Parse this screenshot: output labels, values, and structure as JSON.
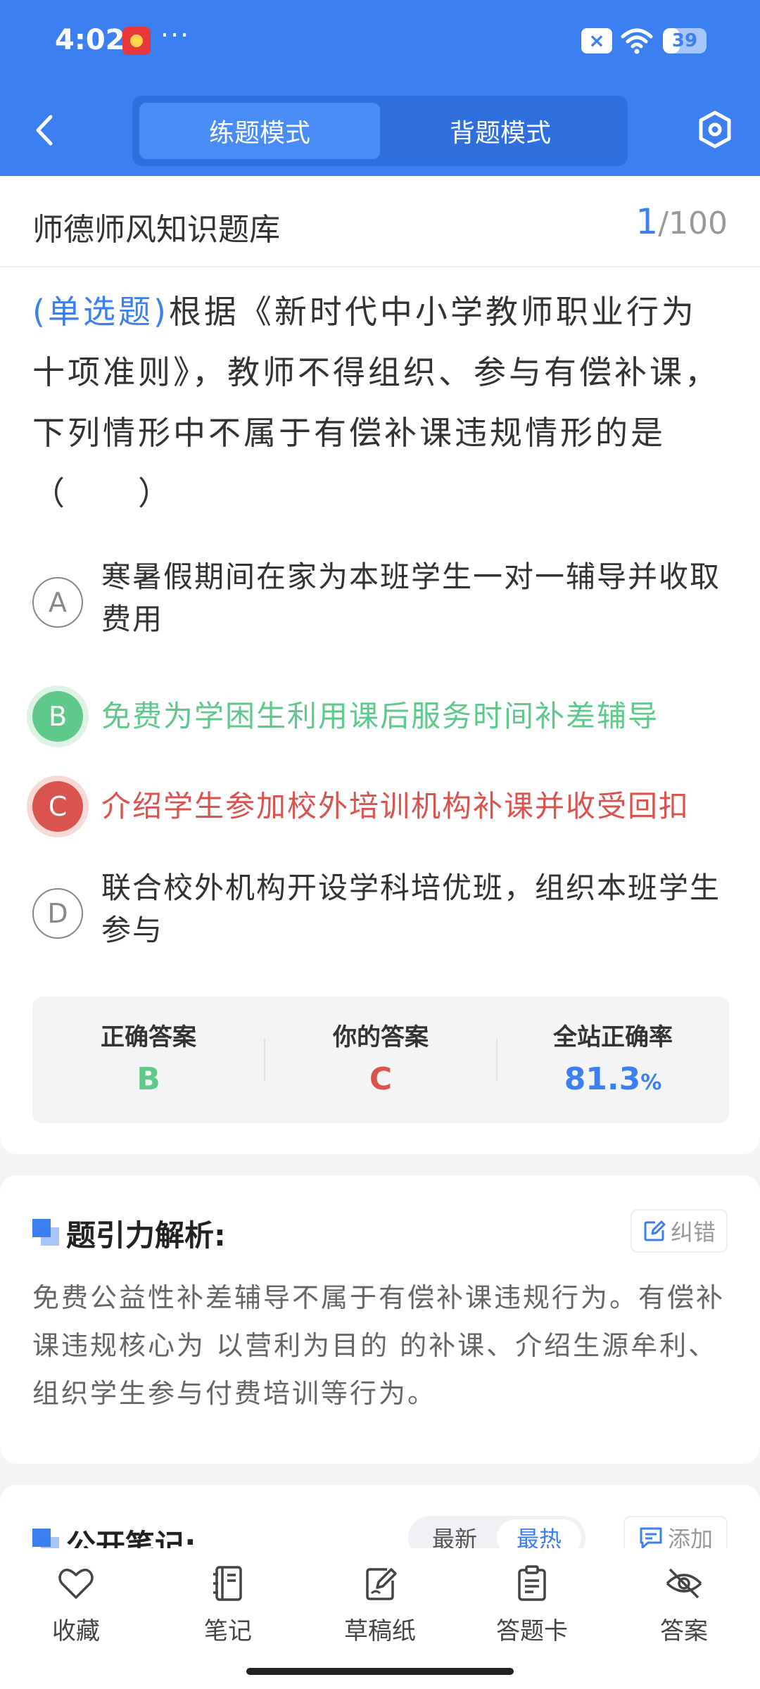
{
  "status_bar": {
    "time": "4:02",
    "more": "···",
    "battery_level": "39",
    "battery_fraction": 0.39
  },
  "top_bar": {
    "modes": [
      "练题模式",
      "背题模式"
    ],
    "active_mode": "练题模式"
  },
  "question_card": {
    "bank_title": "师德师风知识题库",
    "current_index": "1",
    "total": "/100",
    "question_type": "(单选题)",
    "question_text": "根据《新时代中小学教师职业行为十项准则》，教师不得组织、参与有偿补课，下列情形中不属于有偿补课违规情形的是（　　）",
    "options": [
      {
        "letter": "A",
        "text": "寒暑假期间在家为本班学生一对一辅导并收取费用",
        "state": "normal"
      },
      {
        "letter": "B",
        "text": "免费为学困生利用课后服务时间补差辅导",
        "state": "correct"
      },
      {
        "letter": "C",
        "text": "介绍学生参加校外培训机构补课并收受回扣",
        "state": "wrong"
      },
      {
        "letter": "D",
        "text": "联合校外机构开设学科培优班，组织本班学生参与",
        "state": "normal"
      }
    ],
    "stats": {
      "correct_label": "正确答案",
      "correct_value": "B",
      "yours_label": "你的答案",
      "yours_value": "C",
      "rate_label": "全站正确率",
      "rate_value": "81.3",
      "rate_unit": "%"
    }
  },
  "analysis": {
    "title": "题引力解析:",
    "correct_button": "纠错",
    "text": "免费公益性补差辅导不属于有偿补课违规行为。有偿补课违规核心为 以营利为目的 的补课、介绍生源牟利、组织学生参与付费培训等行为。"
  },
  "notes": {
    "title": "公开笔记:",
    "sort_latest": "最新",
    "sort_hot": "最热",
    "add_button": "添加"
  },
  "bottom_nav": [
    "收藏",
    "笔记",
    "草稿纸",
    "答题卡",
    "答案"
  ],
  "colors": {
    "primary": "#3b7ff0",
    "correct": "#5ec98a",
    "wrong": "#d9544f"
  },
  "icons": [
    "back-arrow-icon",
    "settings-hexagon-icon",
    "heart-icon",
    "notebook-icon",
    "draft-icon",
    "answer-card-icon",
    "eye-off-icon",
    "edit-icon",
    "note-add-icon"
  ]
}
